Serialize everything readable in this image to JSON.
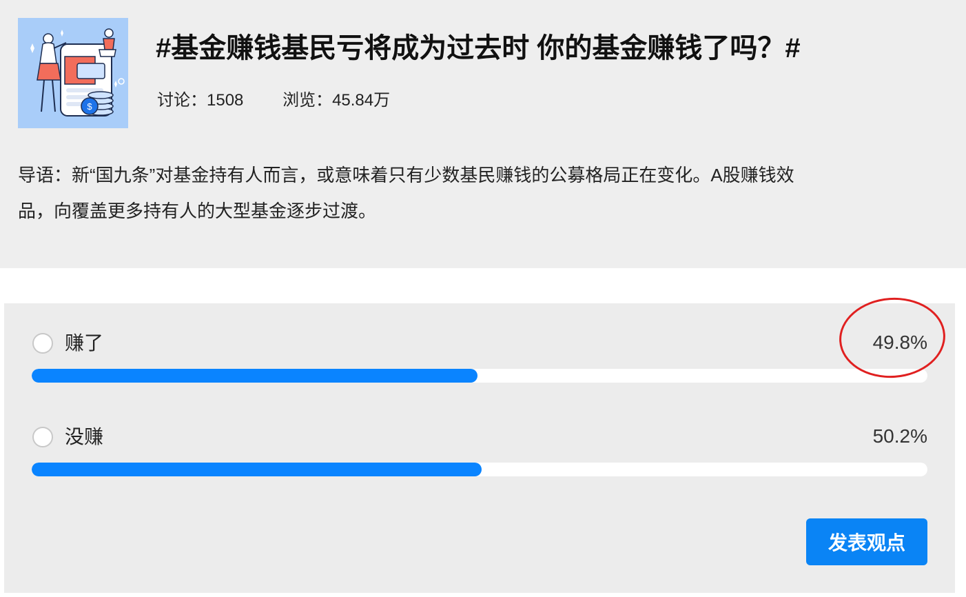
{
  "topic": {
    "title": "#基金赚钱基民亏将成为过去时 你的基金赚钱了吗？#",
    "stats": [
      {
        "label": "讨论：",
        "value": "1508"
      },
      {
        "label": "浏览：",
        "value": "45.84万"
      }
    ],
    "intro_line1": "导语：新“国九条”对基金持有人而言，或意味着只有少数基民赚钱的公募格局正在变化。A股赚钱效",
    "intro_line2": "品，向覆盖更多持有人的大型基金逐步过渡。",
    "cover_icon": "finance-illustration-icon"
  },
  "poll": {
    "options": [
      {
        "label": "赚了",
        "percent_text": "49.8%",
        "bar_fraction": 0.498,
        "highlighted": true
      },
      {
        "label": "没赚",
        "percent_text": "50.2%",
        "bar_fraction": 0.502,
        "highlighted": false
      }
    ],
    "submit_label": "发表观点"
  },
  "colors": {
    "accent": "#0a84ff",
    "button": "#0a84f5",
    "highlight": "#e02020",
    "card_bg": "#eeeeee"
  }
}
